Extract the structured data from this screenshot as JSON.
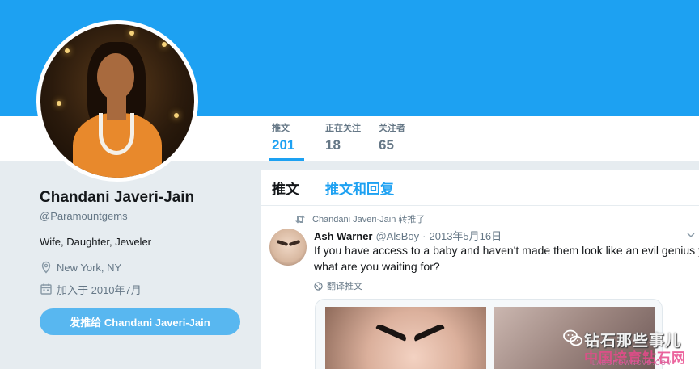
{
  "profile": {
    "name": "Chandani Javeri-Jain",
    "handle": "@Paramountgems",
    "bio": "Wife, Daughter, Jeweler",
    "location": "New York, NY",
    "joined": "加入于 2010年7月",
    "tweet_to_label": "发推给 Chandani Javeri-Jain"
  },
  "stats": [
    {
      "label": "推文",
      "value": "201",
      "active": true
    },
    {
      "label": "正在关注",
      "value": "18",
      "active": false
    },
    {
      "label": "关注者",
      "value": "65",
      "active": false
    }
  ],
  "timeline": {
    "tabs": [
      {
        "label": "推文",
        "active": true
      },
      {
        "label": "推文和回复",
        "active": false
      }
    ],
    "tweet": {
      "retweet_context": "Chandani Javeri-Jain 转推了",
      "fullname": "Ash Warner",
      "username": "@AlsBoy",
      "dot": "·",
      "time": "2013年5月16日",
      "text_line1": "If you have access to a baby and haven't made them look like an evil genius yet,",
      "text_line2": "what are you waiting for?",
      "translate_label": "翻译推文"
    }
  },
  "watermark": {
    "title": "钻石那些事儿",
    "subtitle": "中国培育钻石网",
    "url": "LABGROWNCVD.COM"
  },
  "colors": {
    "brand": "#1da1f2",
    "banner": "#1da1f2",
    "background": "#e6ecf0",
    "secondary_text": "#657786",
    "button": "#58b7f0"
  },
  "icons": [
    "location-icon",
    "calendar-icon",
    "retweet-icon",
    "globe-icon",
    "caret-down-icon",
    "wechat-icon"
  ]
}
